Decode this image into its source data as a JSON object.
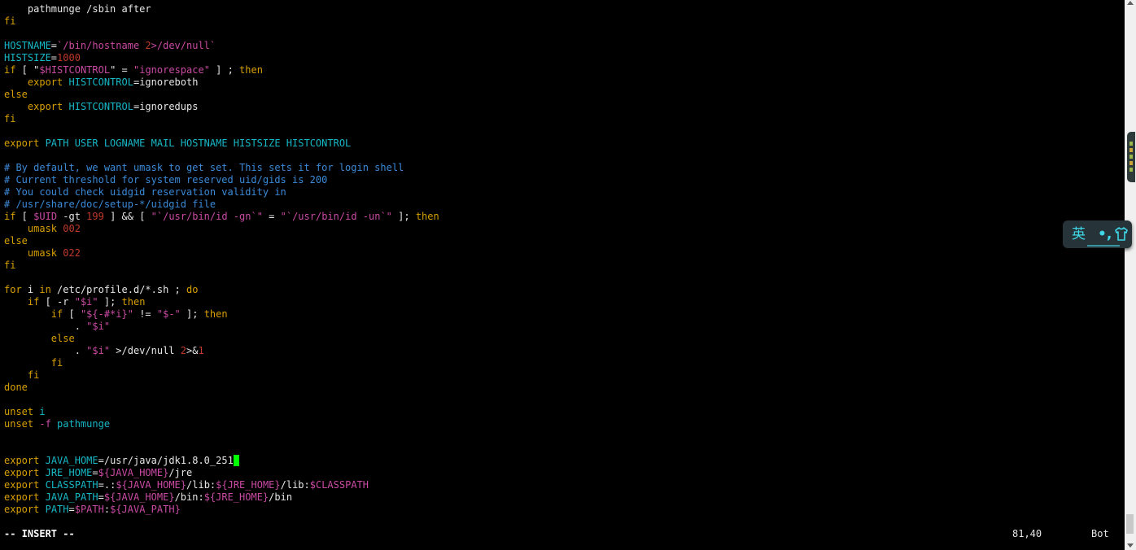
{
  "colors": {
    "background": "#000000",
    "text": "#e6e6e6",
    "keyword": "#d7a000",
    "identifier": "#17b8c6",
    "string": "#c94aa3",
    "number": "#c0392b",
    "comment": "#3a8ad8",
    "variable": "#c94aa3",
    "cursor": "#00ff00"
  },
  "editor": {
    "lines": [
      {
        "row": 0,
        "segments": [
          {
            "t": "    pathmunge /sbin after",
            "c": "text"
          }
        ]
      },
      {
        "row": 1,
        "segments": [
          {
            "t": "fi",
            "c": "keyword"
          }
        ]
      },
      {
        "row": 3,
        "segments": [
          {
            "t": "HOSTNAME",
            "c": "identifier"
          },
          {
            "t": "=",
            "c": "text"
          },
          {
            "t": "`/bin/hostname ",
            "c": "string"
          },
          {
            "t": "2",
            "c": "number"
          },
          {
            "t": ">/dev/null`",
            "c": "string"
          }
        ]
      },
      {
        "row": 4,
        "segments": [
          {
            "t": "HISTSIZE",
            "c": "identifier"
          },
          {
            "t": "=",
            "c": "text"
          },
          {
            "t": "1000",
            "c": "number"
          }
        ]
      },
      {
        "row": 5,
        "segments": [
          {
            "t": "if",
            "c": "keyword"
          },
          {
            "t": " [ ",
            "c": "text"
          },
          {
            "t": "\"",
            "c": "text"
          },
          {
            "t": "$HISTCONTROL",
            "c": "variable"
          },
          {
            "t": "\"",
            "c": "text"
          },
          {
            "t": " = ",
            "c": "text"
          },
          {
            "t": "\"ignorespace\"",
            "c": "string"
          },
          {
            "t": " ] ; ",
            "c": "text"
          },
          {
            "t": "then",
            "c": "keyword"
          }
        ]
      },
      {
        "row": 6,
        "segments": [
          {
            "t": "    ",
            "c": "text"
          },
          {
            "t": "export",
            "c": "keyword"
          },
          {
            "t": " ",
            "c": "text"
          },
          {
            "t": "HISTCONTROL",
            "c": "identifier"
          },
          {
            "t": "=ignoreboth",
            "c": "text"
          }
        ]
      },
      {
        "row": 7,
        "segments": [
          {
            "t": "else",
            "c": "keyword"
          }
        ]
      },
      {
        "row": 8,
        "segments": [
          {
            "t": "    ",
            "c": "text"
          },
          {
            "t": "export",
            "c": "keyword"
          },
          {
            "t": " ",
            "c": "text"
          },
          {
            "t": "HISTCONTROL",
            "c": "identifier"
          },
          {
            "t": "=ignoredups",
            "c": "text"
          }
        ]
      },
      {
        "row": 9,
        "segments": [
          {
            "t": "fi",
            "c": "keyword"
          }
        ]
      },
      {
        "row": 11,
        "segments": [
          {
            "t": "export",
            "c": "keyword"
          },
          {
            "t": " PATH USER LOGNAME MAIL HOSTNAME HISTSIZE HISTCONTROL",
            "c": "identifier"
          }
        ]
      },
      {
        "row": 13,
        "segments": [
          {
            "t": "# By default, we want umask to get set. This sets it for login shell",
            "c": "comment"
          }
        ]
      },
      {
        "row": 14,
        "segments": [
          {
            "t": "# Current threshold for system reserved uid/gids is 200",
            "c": "comment"
          }
        ]
      },
      {
        "row": 15,
        "segments": [
          {
            "t": "# You could check uidgid reservation validity in",
            "c": "comment"
          }
        ]
      },
      {
        "row": 16,
        "segments": [
          {
            "t": "# /usr/share/doc/setup-*/uidgid file",
            "c": "comment"
          }
        ]
      },
      {
        "row": 17,
        "segments": [
          {
            "t": "if",
            "c": "keyword"
          },
          {
            "t": " [ ",
            "c": "text"
          },
          {
            "t": "$UID",
            "c": "variable"
          },
          {
            "t": " -gt ",
            "c": "text"
          },
          {
            "t": "199",
            "c": "number"
          },
          {
            "t": " ] && [ ",
            "c": "text"
          },
          {
            "t": "\"`/usr/bin/id -gn`\"",
            "c": "string"
          },
          {
            "t": " = ",
            "c": "text"
          },
          {
            "t": "\"`/usr/bin/id -un`\"",
            "c": "string"
          },
          {
            "t": " ]; ",
            "c": "text"
          },
          {
            "t": "then",
            "c": "keyword"
          }
        ]
      },
      {
        "row": 18,
        "segments": [
          {
            "t": "    ",
            "c": "text"
          },
          {
            "t": "umask",
            "c": "keyword"
          },
          {
            "t": " ",
            "c": "text"
          },
          {
            "t": "002",
            "c": "number"
          }
        ]
      },
      {
        "row": 19,
        "segments": [
          {
            "t": "else",
            "c": "keyword"
          }
        ]
      },
      {
        "row": 20,
        "segments": [
          {
            "t": "    ",
            "c": "text"
          },
          {
            "t": "umask",
            "c": "keyword"
          },
          {
            "t": " ",
            "c": "text"
          },
          {
            "t": "022",
            "c": "number"
          }
        ]
      },
      {
        "row": 21,
        "segments": [
          {
            "t": "fi",
            "c": "keyword"
          }
        ]
      },
      {
        "row": 23,
        "segments": [
          {
            "t": "for",
            "c": "keyword"
          },
          {
            "t": " i ",
            "c": "text"
          },
          {
            "t": "in",
            "c": "keyword"
          },
          {
            "t": " /etc/profile.d/*.sh ; ",
            "c": "text"
          },
          {
            "t": "do",
            "c": "keyword"
          }
        ]
      },
      {
        "row": 24,
        "segments": [
          {
            "t": "    ",
            "c": "text"
          },
          {
            "t": "if",
            "c": "keyword"
          },
          {
            "t": " [ -r ",
            "c": "text"
          },
          {
            "t": "\"$i\"",
            "c": "string"
          },
          {
            "t": " ]; ",
            "c": "text"
          },
          {
            "t": "then",
            "c": "keyword"
          }
        ]
      },
      {
        "row": 25,
        "segments": [
          {
            "t": "        ",
            "c": "text"
          },
          {
            "t": "if",
            "c": "keyword"
          },
          {
            "t": " [ ",
            "c": "text"
          },
          {
            "t": "\"${-#*i}\"",
            "c": "string"
          },
          {
            "t": " != ",
            "c": "text"
          },
          {
            "t": "\"$-\"",
            "c": "string"
          },
          {
            "t": " ]; ",
            "c": "text"
          },
          {
            "t": "then",
            "c": "keyword"
          }
        ]
      },
      {
        "row": 26,
        "segments": [
          {
            "t": "            . ",
            "c": "text"
          },
          {
            "t": "\"$i\"",
            "c": "string"
          }
        ]
      },
      {
        "row": 27,
        "segments": [
          {
            "t": "        ",
            "c": "text"
          },
          {
            "t": "else",
            "c": "keyword"
          }
        ]
      },
      {
        "row": 28,
        "segments": [
          {
            "t": "            . ",
            "c": "text"
          },
          {
            "t": "\"$i\"",
            "c": "string"
          },
          {
            "t": " >/dev/null ",
            "c": "text"
          },
          {
            "t": "2",
            "c": "number"
          },
          {
            "t": ">&",
            "c": "text"
          },
          {
            "t": "1",
            "c": "number"
          }
        ]
      },
      {
        "row": 29,
        "segments": [
          {
            "t": "        ",
            "c": "text"
          },
          {
            "t": "fi",
            "c": "keyword"
          }
        ]
      },
      {
        "row": 30,
        "segments": [
          {
            "t": "    ",
            "c": "text"
          },
          {
            "t": "fi",
            "c": "keyword"
          }
        ]
      },
      {
        "row": 31,
        "segments": [
          {
            "t": "done",
            "c": "keyword"
          }
        ]
      },
      {
        "row": 33,
        "segments": [
          {
            "t": "unset",
            "c": "keyword"
          },
          {
            "t": " ",
            "c": "text"
          },
          {
            "t": "i",
            "c": "identifier"
          }
        ]
      },
      {
        "row": 34,
        "segments": [
          {
            "t": "unset",
            "c": "keyword"
          },
          {
            "t": " ",
            "c": "text"
          },
          {
            "t": "-f",
            "c": "string"
          },
          {
            "t": " pathmunge",
            "c": "identifier"
          }
        ]
      },
      {
        "row": 37,
        "segments": [
          {
            "t": "export",
            "c": "keyword"
          },
          {
            "t": " ",
            "c": "text"
          },
          {
            "t": "JAVA_HOME",
            "c": "identifier"
          },
          {
            "t": "=/usr/java/jdk1.8.0_251",
            "c": "text"
          }
        ],
        "cursor": true
      },
      {
        "row": 38,
        "segments": [
          {
            "t": "export",
            "c": "keyword"
          },
          {
            "t": " ",
            "c": "text"
          },
          {
            "t": "JRE_HOME",
            "c": "identifier"
          },
          {
            "t": "=",
            "c": "text"
          },
          {
            "t": "${JAVA_HOME}",
            "c": "variable"
          },
          {
            "t": "/jre",
            "c": "text"
          }
        ]
      },
      {
        "row": 39,
        "segments": [
          {
            "t": "export",
            "c": "keyword"
          },
          {
            "t": " ",
            "c": "text"
          },
          {
            "t": "CLASSPATH",
            "c": "identifier"
          },
          {
            "t": "=.:",
            "c": "text"
          },
          {
            "t": "${JAVA_HOME}",
            "c": "variable"
          },
          {
            "t": "/lib:",
            "c": "text"
          },
          {
            "t": "${JRE_HOME}",
            "c": "variable"
          },
          {
            "t": "/lib:",
            "c": "text"
          },
          {
            "t": "$CLASSPATH",
            "c": "variable"
          }
        ]
      },
      {
        "row": 40,
        "segments": [
          {
            "t": "export",
            "c": "keyword"
          },
          {
            "t": " ",
            "c": "text"
          },
          {
            "t": "JAVA_PATH",
            "c": "identifier"
          },
          {
            "t": "=",
            "c": "text"
          },
          {
            "t": "${JAVA_HOME}",
            "c": "variable"
          },
          {
            "t": "/bin:",
            "c": "text"
          },
          {
            "t": "${JRE_HOME}",
            "c": "variable"
          },
          {
            "t": "/bin",
            "c": "text"
          }
        ]
      },
      {
        "row": 41,
        "segments": [
          {
            "t": "export",
            "c": "keyword"
          },
          {
            "t": " ",
            "c": "text"
          },
          {
            "t": "PATH",
            "c": "identifier"
          },
          {
            "t": "=",
            "c": "text"
          },
          {
            "t": "$PATH",
            "c": "variable"
          },
          {
            "t": ":",
            "c": "text"
          },
          {
            "t": "${JAVA_PATH}",
            "c": "variable"
          }
        ]
      }
    ]
  },
  "statusbar": {
    "mode": "-- INSERT --",
    "position": "81,40",
    "scroll": "Bot"
  },
  "ime": {
    "language": "英",
    "punctuation": "•,",
    "skin_icon": "shirt-icon"
  },
  "scrollbar": {
    "up_icon": "arrow-up-icon",
    "down_icon": "arrow-down-icon"
  }
}
